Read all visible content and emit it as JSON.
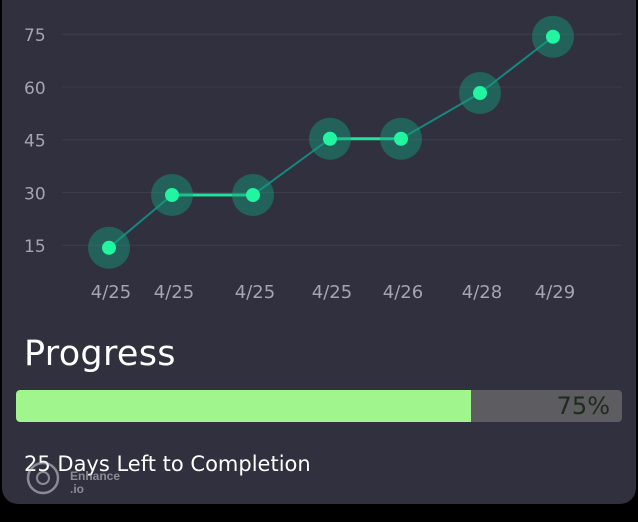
{
  "chart_data": {
    "type": "line",
    "categories": [
      "4/25",
      "4/25",
      "4/25",
      "4/25",
      "4/26",
      "4/28",
      "4/29"
    ],
    "values": [
      14,
      29,
      29,
      45,
      45,
      58,
      74
    ],
    "y_ticks": [
      "75",
      "60",
      "45",
      "30",
      "15"
    ],
    "ylim": [
      0,
      80
    ],
    "grid": true,
    "colors": {
      "line": "#17867f",
      "point": "#22f59f",
      "halo": "#159f7c",
      "grid": "#3c3c4a",
      "tick_text": "#a4a4b2"
    }
  },
  "progress": {
    "title": "Progress",
    "value": 0.75,
    "label": "75%",
    "colors": {
      "fill": "#a0f58c",
      "track": "#5c5c61"
    }
  },
  "completion_text": "25 Days Left to Completion",
  "watermark": {
    "line1": "Enhance",
    "line2": ".io"
  }
}
